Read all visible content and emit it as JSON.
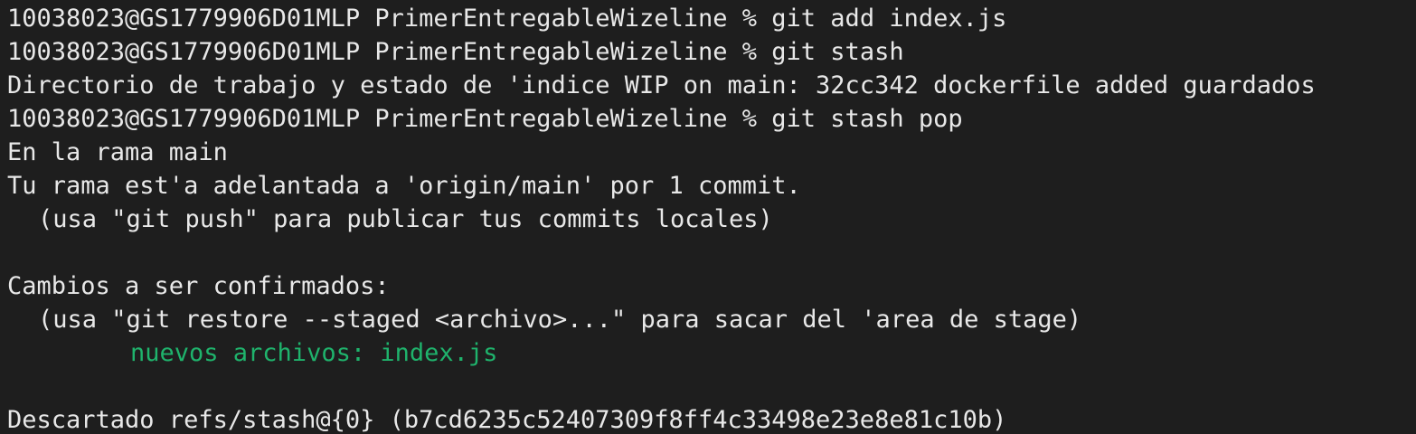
{
  "colors": {
    "background": "#1e1e1e",
    "text": "#e8e8e8",
    "staged_file": "#1fb36c"
  },
  "terminal": {
    "prompt": "10038023@GS1779906D01MLP PrimerEntregableWizeline % ",
    "lines": [
      {
        "kind": "command",
        "text": "git add index.js"
      },
      {
        "kind": "command",
        "text": "git stash"
      },
      {
        "kind": "output",
        "text": "Directorio de trabajo y estado de 'indice WIP on main: 32cc342 dockerfile added guardados"
      },
      {
        "kind": "command",
        "text": "git stash pop"
      },
      {
        "kind": "output",
        "text": "En la rama main"
      },
      {
        "kind": "output",
        "text": "Tu rama est'a adelantada a 'origin/main' por 1 commit."
      },
      {
        "kind": "output",
        "text": "(usa \"git push\" para publicar tus commits locales)"
      },
      {
        "kind": "blank",
        "text": ""
      },
      {
        "kind": "output",
        "text": "Cambios a ser confirmados:"
      },
      {
        "kind": "output",
        "text": "(usa \"git restore --staged <archivo>...\" para sacar del 'area de stage)"
      },
      {
        "kind": "staged",
        "text": "nuevos archivos: index.js"
      },
      {
        "kind": "blank",
        "text": ""
      },
      {
        "kind": "output",
        "text": "Descartado refs/stash@{0} (b7cd6235c52407309f8ff4c33498e23e8e81c10b)"
      }
    ]
  }
}
